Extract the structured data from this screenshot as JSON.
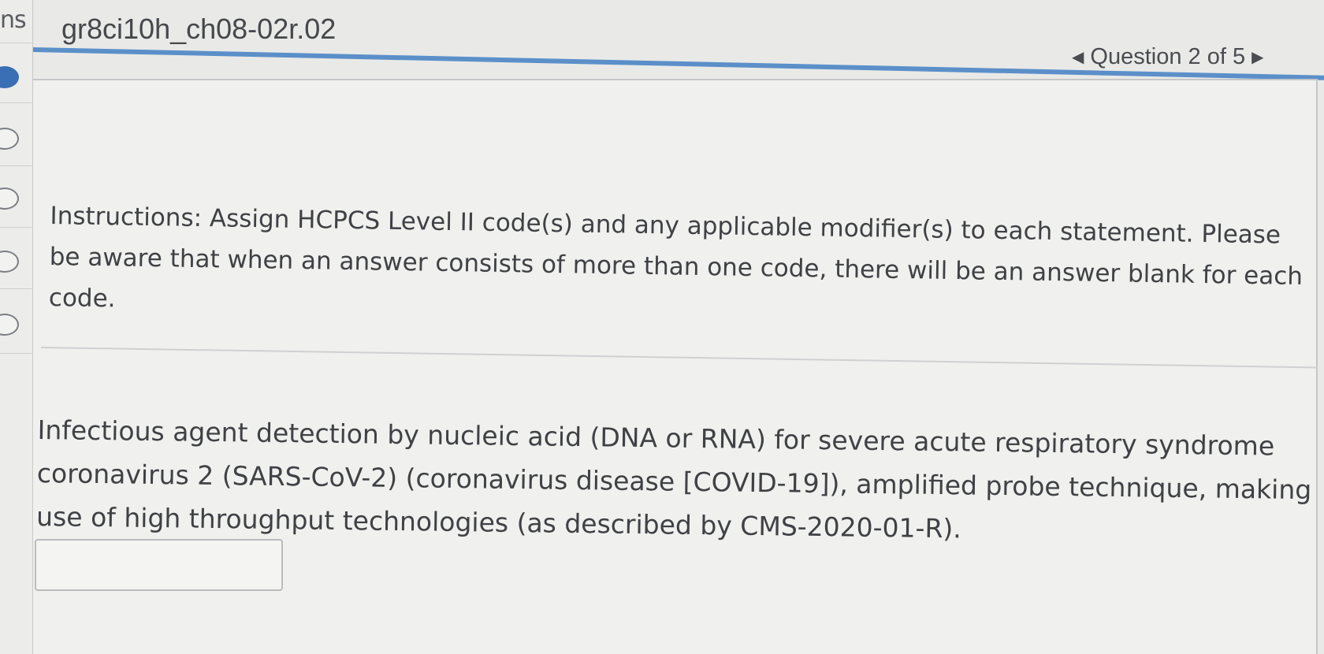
{
  "rail": {
    "tab_label": "ns"
  },
  "header": {
    "assignment_title": "gr8ci10h_ch08-02r.02",
    "question_nav": {
      "prev_icon": "triangle-left-icon",
      "label": "Question 2 of 5",
      "next_icon": "triangle-right-icon"
    }
  },
  "question": {
    "instructions": "Instructions: Assign HCPCS Level II code(s) and any applicable modifier(s) to each statement. Please be aware that when an answer consists of more than one code, there will be an answer blank for each code.",
    "statement": "Infectious agent detection by nucleic acid (DNA or RNA) for severe acute respiratory syndrome coronavirus 2 (SARS-CoV-2) (coronavirus disease [COVID-19]), amplified probe technique, making use of high throughput technologies (as described by CMS-2020-01-R).",
    "answer_value": ""
  },
  "colors": {
    "accent": "#5b8fc9",
    "current_question_dot": "#3a6fb5",
    "background": "#e9e9e7"
  }
}
